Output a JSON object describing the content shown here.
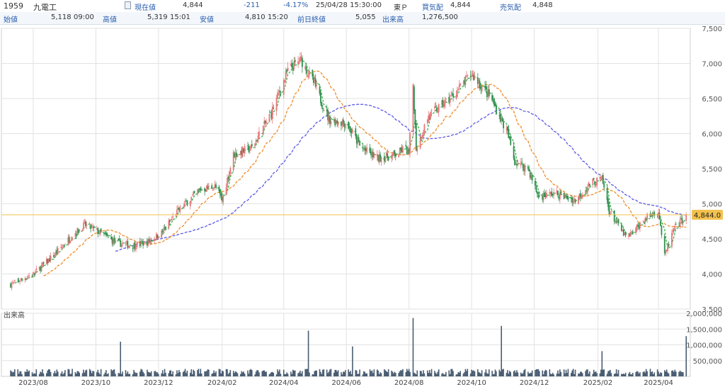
{
  "header": {
    "code": "1959",
    "name": "九電工",
    "current_label": "現在値",
    "current_value": "4,844",
    "change": "-211",
    "change_pct": "-4.17%",
    "date_time": "25/04/28  15:30:00",
    "market": "東Ｐ",
    "bid_label": "買気配",
    "bid_value": "4,844",
    "ask_label": "売気配",
    "ask_value": "4,848",
    "open_label": "始値",
    "open_value": "5,118",
    "open_time": "09:00",
    "high_label": "高値",
    "high_value": "5,319",
    "high_time": "15:01",
    "low_label": "安値",
    "low_value": "4,810",
    "low_time": "15:20",
    "prev_close_label": "前日終値",
    "prev_close_value": "5,055",
    "volume_label": "出来高",
    "volume_value": "1,276,500"
  },
  "colors": {
    "up": "#e6787a",
    "down": "#2f8f4e",
    "ma_short": "#37b34a",
    "ma_mid": "#f08c28",
    "ma_long": "#5a5ae6",
    "price_line": "#f2c14e",
    "volume_bar": "#4a5d72",
    "grid": "#e2e2e2"
  },
  "chart_data": {
    "type": "candlestick",
    "price_axis": {
      "min": 3500,
      "max": 7500,
      "ticks": [
        "3,500",
        "4,000",
        "4,500",
        "5,000",
        "5,500",
        "6,000",
        "6,500",
        "7,000",
        "7,500"
      ]
    },
    "volume_axis": {
      "min": 0,
      "max": 2000000,
      "ticks": [
        "500,000",
        "1,000,000",
        "1,500,000",
        "2,000,000"
      ]
    },
    "x_ticks": [
      "2023/08",
      "2023/10",
      "2023/12",
      "2024/02",
      "2024/04",
      "2024/06",
      "2024/08",
      "2024/10",
      "2024/12",
      "2025/02",
      "2025/04"
    ],
    "volume_panel_label": "出来高",
    "current_price_label": "4,844.0",
    "current_price": 4844,
    "price_path": [
      [
        "2023-07-10",
        3850
      ],
      [
        "2023-08-01",
        4000
      ],
      [
        "2023-08-20",
        4250
      ],
      [
        "2023-09-08",
        4550
      ],
      [
        "2023-09-20",
        4700
      ],
      [
        "2023-10-01",
        4620
      ],
      [
        "2023-10-20",
        4450
      ],
      [
        "2023-11-05",
        4400
      ],
      [
        "2023-11-20",
        4450
      ],
      [
        "2023-12-05",
        4600
      ],
      [
        "2023-12-20",
        4900
      ],
      [
        "2024-01-10",
        5200
      ],
      [
        "2024-01-25",
        5250
      ],
      [
        "2024-02-01",
        5050
      ],
      [
        "2024-02-12",
        5700
      ],
      [
        "2024-03-01",
        5800
      ],
      [
        "2024-03-20",
        6300
      ],
      [
        "2024-04-05",
        6900
      ],
      [
        "2024-04-18",
        7050
      ],
      [
        "2024-05-01",
        6700
      ],
      [
        "2024-05-15",
        6200
      ],
      [
        "2024-06-01",
        6150
      ],
      [
        "2024-06-15",
        5800
      ],
      [
        "2024-07-01",
        5650
      ],
      [
        "2024-07-20",
        5700
      ],
      [
        "2024-07-28",
        5800
      ],
      [
        "2024-08-01",
        5700
      ],
      [
        "2024-08-05",
        6700
      ],
      [
        "2024-08-08",
        5800
      ],
      [
        "2024-08-20",
        6250
      ],
      [
        "2024-09-10",
        6500
      ],
      [
        "2024-10-01",
        6850
      ],
      [
        "2024-10-20",
        6500
      ],
      [
        "2024-11-05",
        6000
      ],
      [
        "2024-11-12",
        5600
      ],
      [
        "2024-11-25",
        5500
      ],
      [
        "2024-12-05",
        5100
      ],
      [
        "2024-12-20",
        5150
      ],
      [
        "2025-01-10",
        5050
      ],
      [
        "2025-01-25",
        5300
      ],
      [
        "2025-02-05",
        5350
      ],
      [
        "2025-02-12",
        4900
      ],
      [
        "2025-03-01",
        4500
      ],
      [
        "2025-03-20",
        4800
      ],
      [
        "2025-04-01",
        4900
      ],
      [
        "2025-04-07",
        4250
      ],
      [
        "2025-04-15",
        4600
      ],
      [
        "2025-04-28",
        4844
      ]
    ],
    "volume_spikes": [
      [
        "2023-10-25",
        1100000
      ],
      [
        "2024-04-25",
        1450000
      ],
      [
        "2024-06-08",
        950000
      ],
      [
        "2024-08-05",
        1850000
      ],
      [
        "2024-10-30",
        1600000
      ],
      [
        "2025-02-05",
        800000
      ],
      [
        "2025-04-28",
        1276500
      ]
    ]
  }
}
